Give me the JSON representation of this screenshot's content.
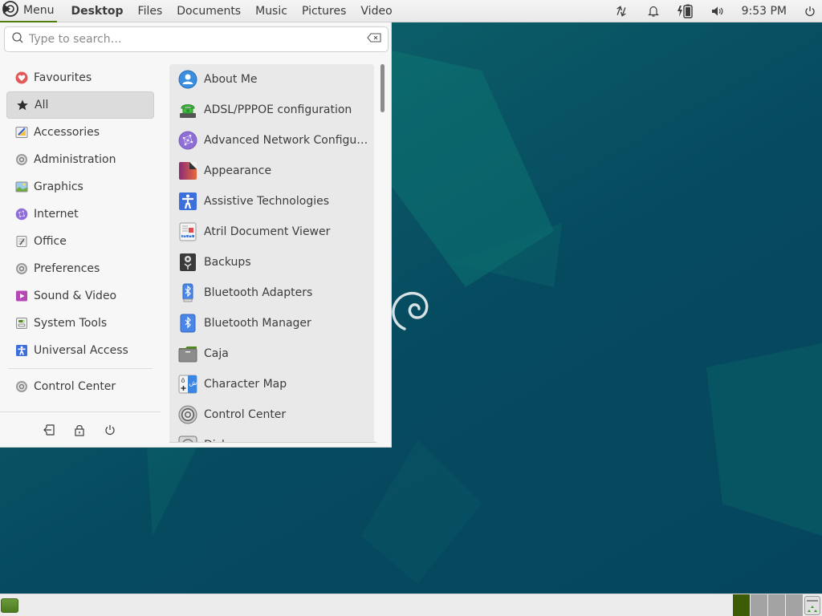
{
  "top_panel": {
    "menu_label": "Menu",
    "places": [
      {
        "label": "Desktop",
        "active": true
      },
      {
        "label": "Files",
        "active": false
      },
      {
        "label": "Documents",
        "active": false
      },
      {
        "label": "Music",
        "active": false
      },
      {
        "label": "Pictures",
        "active": false
      },
      {
        "label": "Video",
        "active": false
      }
    ],
    "tray_icons": [
      "network-transfer-icon",
      "notification-bell-icon",
      "battery-charging-icon",
      "volume-icon"
    ],
    "clock": "9:53 PM",
    "power_icon": "power-icon"
  },
  "menu": {
    "search": {
      "placeholder": "Type to search…",
      "value": ""
    },
    "categories": [
      {
        "label": "Favourites",
        "icon": "heart-icon",
        "selected": false
      },
      {
        "label": "All",
        "icon": "star-icon",
        "selected": true
      },
      {
        "label": "Accessories",
        "icon": "accessories-icon",
        "selected": false
      },
      {
        "label": "Administration",
        "icon": "administration-icon",
        "selected": false
      },
      {
        "label": "Graphics",
        "icon": "graphics-icon",
        "selected": false
      },
      {
        "label": "Internet",
        "icon": "internet-icon",
        "selected": false
      },
      {
        "label": "Office",
        "icon": "office-icon",
        "selected": false
      },
      {
        "label": "Preferences",
        "icon": "preferences-icon",
        "selected": false
      },
      {
        "label": "Sound & Video",
        "icon": "sound-video-icon",
        "selected": false
      },
      {
        "label": "System Tools",
        "icon": "system-tools-icon",
        "selected": false
      },
      {
        "label": "Universal Access",
        "icon": "universal-access-icon",
        "selected": false
      }
    ],
    "control_center": {
      "label": "Control Center",
      "icon": "control-center-icon"
    },
    "session_buttons": [
      "logout-icon",
      "lock-icon",
      "shutdown-icon"
    ],
    "apps": [
      {
        "label": "About Me",
        "icon": "about-me-icon"
      },
      {
        "label": "ADSL/PPPOE configuration",
        "icon": "adsl-phone-icon"
      },
      {
        "label": "Advanced Network Configu…",
        "icon": "network-globe-icon"
      },
      {
        "label": "Appearance",
        "icon": "appearance-icon"
      },
      {
        "label": "Assistive Technologies",
        "icon": "assistive-technologies-icon"
      },
      {
        "label": "Atril Document Viewer",
        "icon": "document-viewer-icon"
      },
      {
        "label": "Backups",
        "icon": "backups-icon"
      },
      {
        "label": "Bluetooth Adapters",
        "icon": "bluetooth-adapters-icon"
      },
      {
        "label": "Bluetooth Manager",
        "icon": "bluetooth-manager-icon"
      },
      {
        "label": "Caja",
        "icon": "folder-icon"
      },
      {
        "label": "Character Map",
        "icon": "character-map-icon"
      },
      {
        "label": "Control Center",
        "icon": "control-center-icon"
      },
      {
        "label": "Disks",
        "icon": "disks-icon"
      }
    ],
    "scroll_position_fraction": 0.0
  },
  "bottom_panel": {
    "show_desktop_icon": "show-desktop-icon",
    "workspaces": [
      {
        "index": 1,
        "active": true
      },
      {
        "index": 2,
        "active": false
      },
      {
        "index": 3,
        "active": false
      },
      {
        "index": 4,
        "active": false
      }
    ],
    "trash_icon": "trash-icon"
  },
  "colors": {
    "accent": "#4e7d0e",
    "wallpaper": "#06485e",
    "active_workspace": "#3d5c06"
  }
}
